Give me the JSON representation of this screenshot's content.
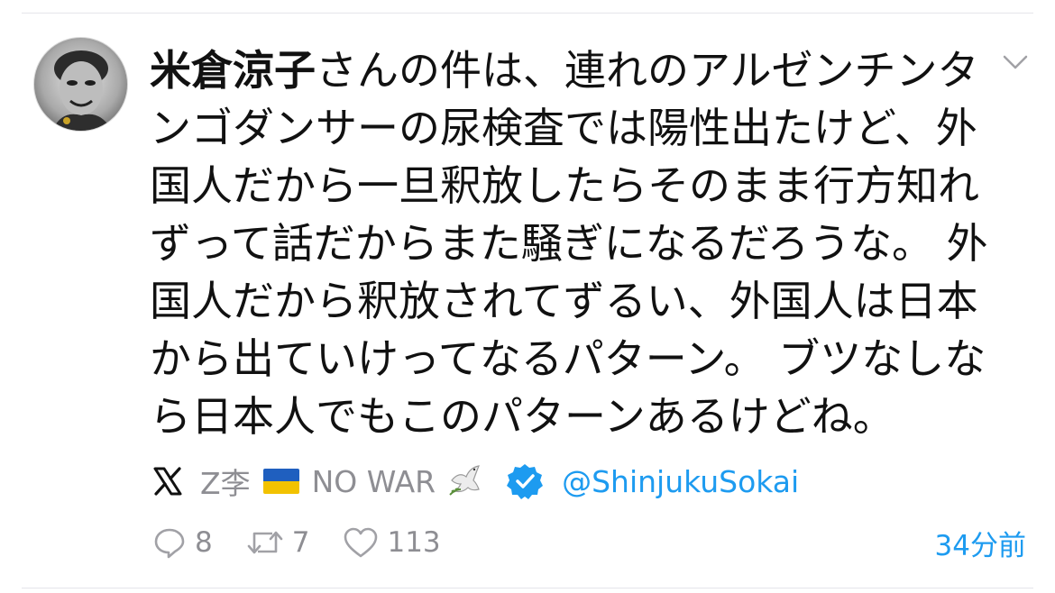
{
  "tweet": {
    "author_name": "米倉涼子",
    "lines": [
      "さんの件は、連れのアルゼンチンタ",
      "ンゴダンサーの尿検査では陽性出たけど、外",
      "国人だから一旦釈放したらそのまま行方知れ",
      "ずって話だからまた騒ぎになるだろうな。 外",
      "国人だから釈放されてずるい、外国人は日本",
      "から出ていけってなるパターン。 ブツなしな",
      "ら日本人でもこのパターンあるけどね。"
    ]
  },
  "source": {
    "platform_icon": "x-logo-icon",
    "display_name": "Z李",
    "flag_icon": "ukraine-flag-icon",
    "no_war": "NO WAR",
    "dove_icon": "dove-icon",
    "verified_icon": "verified-badge-icon",
    "handle": "@ShinjukuSokai"
  },
  "actions": {
    "replies": "8",
    "retweets": "7",
    "likes": "113",
    "timestamp": "34分前"
  },
  "colors": {
    "accent": "#1d9bf0",
    "muted": "#8e8e93",
    "text": "#111111"
  }
}
